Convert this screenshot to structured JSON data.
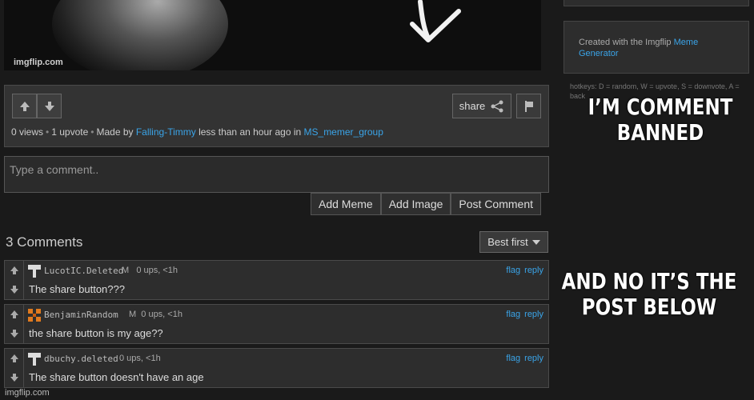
{
  "meme_image": {
    "watermark": "imgflip.com"
  },
  "post": {
    "share_label": "share",
    "views": "0 views",
    "upvotes": "1 upvote",
    "made_by_prefix": "Made by",
    "author": "Falling-Timmy",
    "time_prefix": "less than an hour ago in",
    "stream": "MS_memer_group"
  },
  "comment_box": {
    "placeholder": "Type a comment..",
    "add_meme": "Add Meme",
    "add_image": "Add Image",
    "post_comment": "Post Comment"
  },
  "comments_section": {
    "title": "3 Comments",
    "sort_label": "Best first"
  },
  "comments": [
    {
      "user": "LucotIC.Deleted",
      "info": "M   0 ups, <1h",
      "text": "The share button???",
      "flag": "flag",
      "reply": "reply"
    },
    {
      "user": "BenjaminRandom",
      "info": "M  0 ups, <1h",
      "text": "the share button is my age??",
      "flag": "flag",
      "reply": "reply"
    },
    {
      "user": "dbuchy.deleted",
      "info": "0 ups, <1h",
      "text": "The share button doesn't have an age",
      "flag": "flag",
      "reply": "reply"
    }
  ],
  "sidebar": {
    "created_prefix": "Created with the Imgflip ",
    "created_link": "Meme Generator",
    "hotkeys": "hotkeys: D = random, W = upvote, S = downvote, A = back"
  },
  "captions": {
    "top": "I’M COMMENT BANNED",
    "bottom": "AND NO IT’S THE POST BELOW"
  },
  "footer": {
    "watermark": "imgflip.com"
  },
  "colors": {
    "link": "#3aa4e8",
    "background": "#1a1a1a",
    "panel": "#333333"
  }
}
